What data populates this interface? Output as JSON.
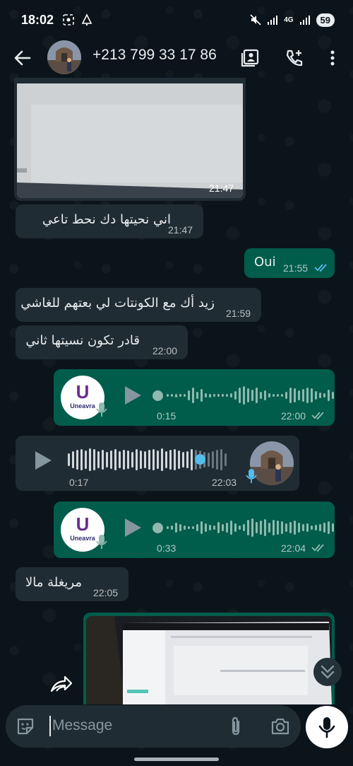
{
  "status_bar": {
    "time": "18:02",
    "network_label": "4G",
    "battery": "59"
  },
  "header": {
    "contact_name": "+213 799 33 17 86"
  },
  "messages": {
    "m1": {
      "time": "21:47"
    },
    "m2": {
      "text": "اني نحيتها دك نحط تاعي",
      "time": "21:47"
    },
    "m3": {
      "text": "Oui",
      "time": "21:55"
    },
    "m4": {
      "text": "زيد أك مع الكونتات لي بعتهم للغاشي",
      "time": "21:59"
    },
    "m5": {
      "text": "قادر تكون نسيتها ثاني",
      "time": "22:00"
    },
    "m6": {
      "duration": "0:15",
      "time": "22:00",
      "avatar_text": "Uneavra"
    },
    "m7": {
      "duration": "0:17",
      "time": "22:03"
    },
    "m8": {
      "duration": "0:33",
      "time": "22:04",
      "avatar_text": "Uneavra"
    },
    "m9": {
      "text": "مريغلة مالا",
      "time": "22:05"
    }
  },
  "composer": {
    "placeholder": "Message"
  },
  "colors": {
    "background": "#0b141a",
    "incoming_bubble": "#202c33",
    "outgoing_bubble": "#005c4b",
    "read_ticks": "#53bdeb",
    "voice_knob": "#53bdeb"
  }
}
